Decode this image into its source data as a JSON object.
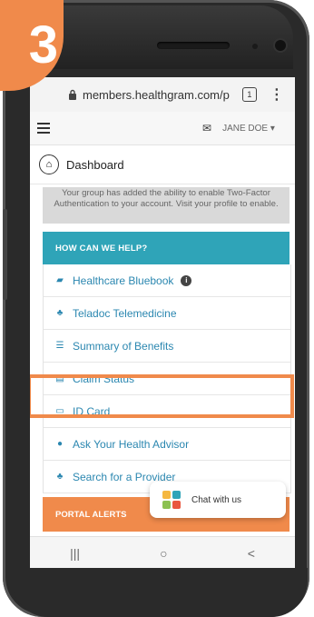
{
  "step_badge": "3",
  "browser": {
    "url": "members.healthgram.com/p",
    "tab_count": "1"
  },
  "header": {
    "user_name": "JANE DOE",
    "user_caret": "▾"
  },
  "dashboard": {
    "title": "Dashboard"
  },
  "notice": {
    "text": "Your group has added the ability to enable Two-Factor Authentication to your account. Visit your profile to enable."
  },
  "help": {
    "heading": "HOW CAN WE HELP?",
    "items": [
      {
        "label": "Healthcare Bluebook",
        "icon": "book-icon"
      },
      {
        "label": "Teladoc Telemedicine",
        "icon": "doctor-icon"
      },
      {
        "label": "Summary of Benefits",
        "icon": "list-icon"
      },
      {
        "label": "Claim Status",
        "icon": "clipboard-icon"
      },
      {
        "label": "ID Card",
        "icon": "id-card-icon"
      },
      {
        "label": "Ask Your Health Advisor",
        "icon": "chat-bubbles-icon"
      },
      {
        "label": "Search for a Provider",
        "icon": "doctor-icon"
      }
    ]
  },
  "alerts": {
    "heading": "PORTAL ALERTS"
  },
  "chat": {
    "label": "Chat with us"
  },
  "navbar": {
    "recents": "|||",
    "home": "○",
    "back": "<"
  },
  "colors": {
    "accent_teal": "#2fa4b8",
    "accent_orange": "#f08a4b",
    "link_blue": "#2b87b0"
  }
}
